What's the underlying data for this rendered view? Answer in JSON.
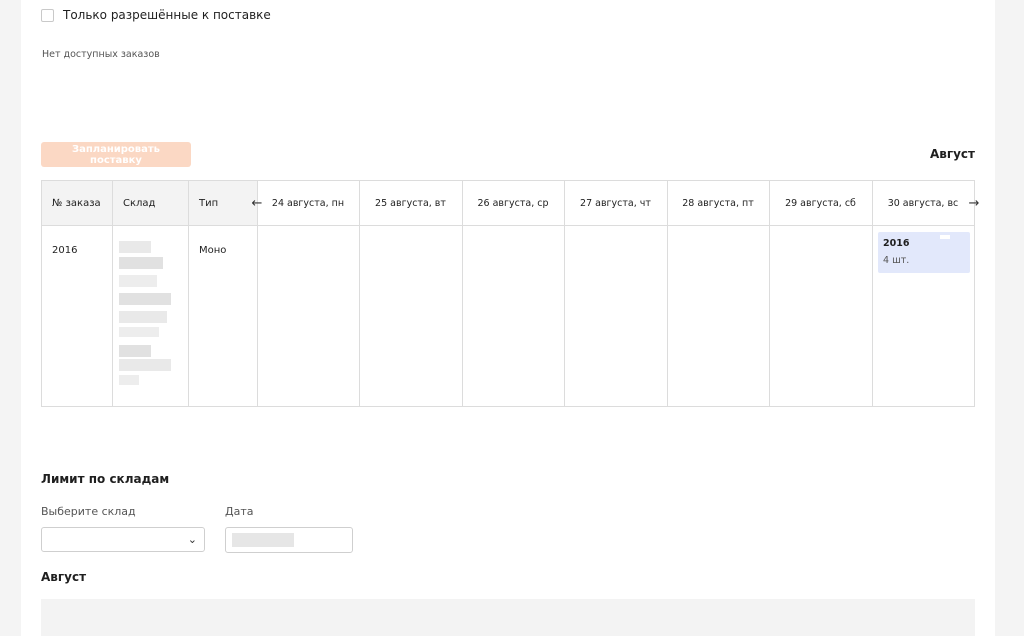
{
  "filter": {
    "only_allowed_label": "Только разрешённые к поставке"
  },
  "empty_orders_text": "Нет доступных заказов",
  "plan_button_label": "Запланировать поставку",
  "calendar": {
    "month": "Август",
    "headers": {
      "order_no": "№ заказа",
      "warehouse": "Склад",
      "type": "Тип"
    },
    "days": [
      "24 августа, пн",
      "25 августа, вт",
      "26 августа, ср",
      "27 августа, чт",
      "28 августа, пт",
      "29 августа, сб",
      "30 августа, вс"
    ],
    "prev_icon": "arrow-left-icon",
    "next_icon": "arrow-right-icon",
    "rows": [
      {
        "order_no": "2016",
        "type": "Моно"
      }
    ],
    "entry": {
      "order_no": "2016",
      "qty": "4 шт."
    }
  },
  "limits": {
    "title": "Лимит по складам",
    "warehouse_label": "Выберите склад",
    "warehouse_value": "",
    "date_label": "Дата",
    "month": "Август"
  },
  "colors": {
    "plan_button_bg": "#fbd8c4",
    "entry_chip_bg": "#e2e8fb"
  }
}
